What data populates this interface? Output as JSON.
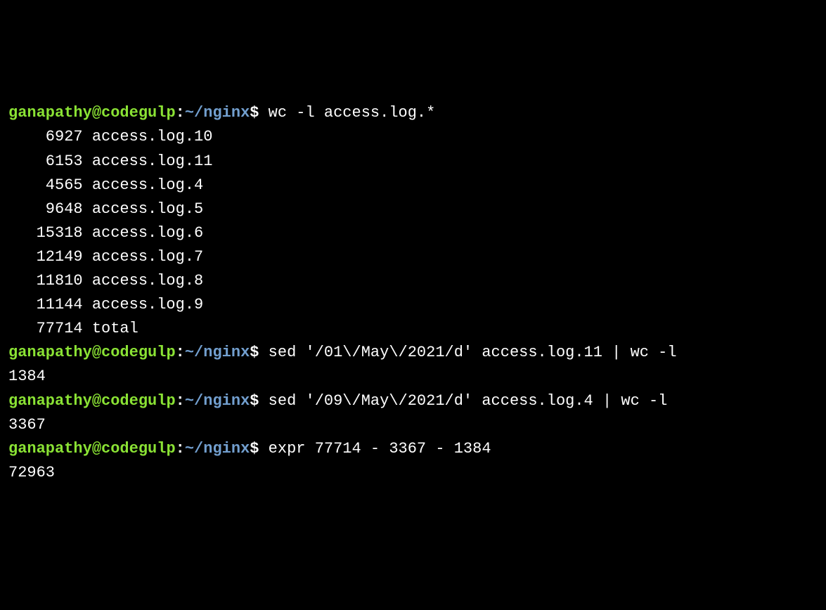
{
  "prompt": {
    "user": "ganapathy",
    "at": "@",
    "host": "codegulp",
    "colon": ":",
    "path": "~/nginx",
    "dollar": "$"
  },
  "blocks": [
    {
      "command": " wc -l access.log.*",
      "output": [
        "    6927 access.log.10",
        "    6153 access.log.11",
        "    4565 access.log.4",
        "    9648 access.log.5",
        "   15318 access.log.6",
        "   12149 access.log.7",
        "   11810 access.log.8",
        "   11144 access.log.9",
        "   77714 total"
      ]
    },
    {
      "command": " sed '/01\\/May\\/2021/d' access.log.11 | wc -l",
      "output": [
        "1384"
      ]
    },
    {
      "command": " sed '/09\\/May\\/2021/d' access.log.4 | wc -l",
      "output": [
        "3367"
      ]
    },
    {
      "command": " expr 77714 - 3367 - 1384",
      "output": [
        "72963"
      ]
    }
  ]
}
